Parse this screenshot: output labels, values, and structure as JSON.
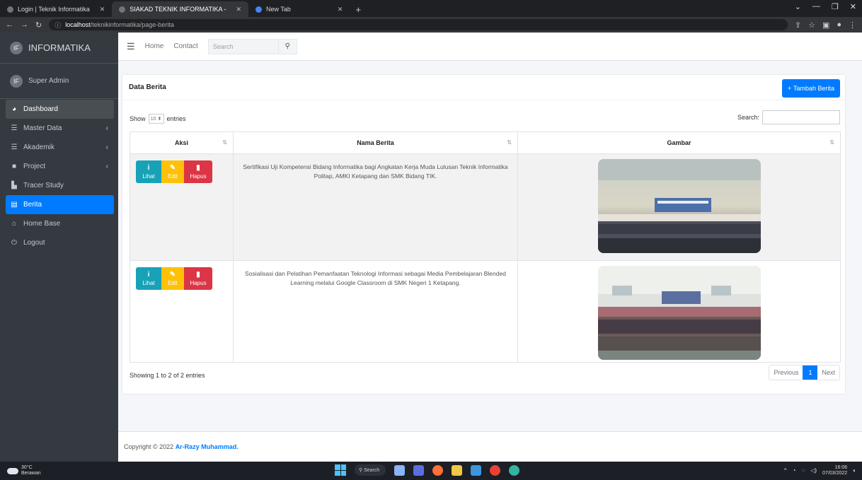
{
  "browser": {
    "tabs": [
      {
        "title": "Login | Teknik Informatika",
        "active": false
      },
      {
        "title": "SIAKAD TEKNIK INFORMATIKA - ",
        "active": true
      },
      {
        "title": "New Tab",
        "active": false
      }
    ],
    "url_host": "localhost",
    "url_path": "/teknikinformatika/page-berita"
  },
  "sidebar": {
    "brand": "INFORMATIKA",
    "brand_badge": "IF",
    "user_badge": "IF",
    "user_name": "Super Admin",
    "items": [
      {
        "label": "Dashboard",
        "icon": "dashboard-icon",
        "caret": false
      },
      {
        "label": "Master Data",
        "icon": "list-icon",
        "caret": true
      },
      {
        "label": "Akademik",
        "icon": "list-icon",
        "caret": true
      },
      {
        "label": "Project",
        "icon": "book-icon",
        "caret": true
      },
      {
        "label": "Tracer Study",
        "icon": "chart-icon",
        "caret": false
      },
      {
        "label": "Berita",
        "icon": "newspaper-icon",
        "caret": false
      },
      {
        "label": "Home Base",
        "icon": "home-icon",
        "caret": false
      },
      {
        "label": "Logout",
        "icon": "logout-icon",
        "caret": false
      }
    ]
  },
  "topnav": {
    "home": "Home",
    "contact": "Contact",
    "search_placeholder": "Search"
  },
  "card": {
    "title": "Data Berita",
    "add_button": "Tambah Berita",
    "show_label": "Show",
    "show_value": "10",
    "entries_label": "entries",
    "search_label": "Search:",
    "columns": [
      "Aksi",
      "Nama Berita",
      "Gambar"
    ],
    "rows": [
      {
        "nama": "Sertifikasi Uji Kompetensi Bidang Informatika bagi Angkatan Kerja Muda Lulusan Teknik Informatika Politap, AMKI Ketapang dan SMK Bidang TIK."
      },
      {
        "nama": "Sosialisasi dan Pelatihan Pemanfaatan Teknologi Informasi sebagai Media Pembelajaran Blended Learning melalui Google Classroom di SMK Negeri 1 Ketapang."
      }
    ],
    "btn_lihat": "Lihat",
    "btn_edit": "Edit",
    "btn_hapus": "Hapus",
    "showing": "Showing 1 to 2 of 2 entries",
    "pager": {
      "prev": "Previous",
      "page": "1",
      "next": "Next"
    }
  },
  "footer": {
    "prefix": "Copyright © 2022",
    "author": "Ar-Razy Muhammad."
  },
  "taskbar": {
    "temp": "30°C",
    "weather": "Berawan",
    "search": "Search",
    "time": "16:06",
    "date": "07/03/2022"
  }
}
